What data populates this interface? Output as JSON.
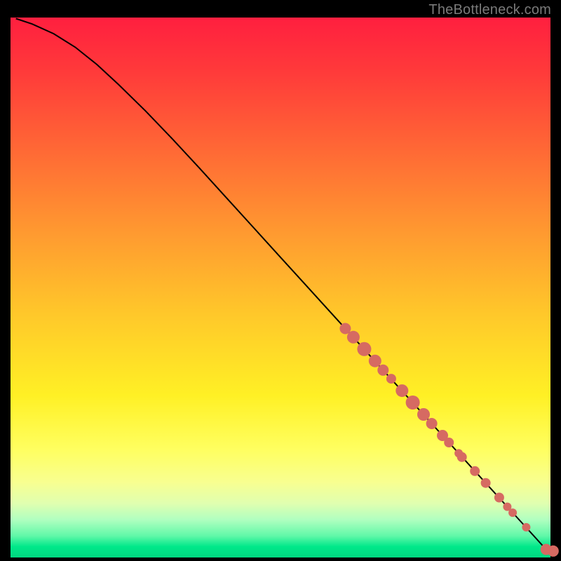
{
  "watermark": "TheBottleneck.com",
  "chart_data": {
    "type": "scatter",
    "title": "",
    "xlabel": "",
    "ylabel": "",
    "xlim": [
      0,
      100
    ],
    "ylim": [
      0,
      100
    ],
    "curve": [
      {
        "x": 1.0,
        "y": 99.8
      },
      {
        "x": 4.0,
        "y": 98.8
      },
      {
        "x": 8.0,
        "y": 97.0
      },
      {
        "x": 12.0,
        "y": 94.5
      },
      {
        "x": 16.0,
        "y": 91.3
      },
      {
        "x": 20.0,
        "y": 87.6
      },
      {
        "x": 25.0,
        "y": 82.7
      },
      {
        "x": 30.0,
        "y": 77.5
      },
      {
        "x": 35.0,
        "y": 72.1
      },
      {
        "x": 40.0,
        "y": 66.6
      },
      {
        "x": 45.0,
        "y": 61.1
      },
      {
        "x": 50.0,
        "y": 55.6
      },
      {
        "x": 55.0,
        "y": 50.1
      },
      {
        "x": 60.0,
        "y": 44.6
      },
      {
        "x": 65.0,
        "y": 39.1
      },
      {
        "x": 70.0,
        "y": 33.6
      },
      {
        "x": 75.0,
        "y": 28.1
      },
      {
        "x": 80.0,
        "y": 22.6
      },
      {
        "x": 85.0,
        "y": 17.1
      },
      {
        "x": 90.0,
        "y": 11.6
      },
      {
        "x": 95.0,
        "y": 6.1
      },
      {
        "x": 99.0,
        "y": 1.7
      }
    ],
    "series": [
      {
        "name": "points",
        "color": "#d66a62",
        "points": [
          {
            "x": 62.0,
            "y": 42.4,
            "r": 8
          },
          {
            "x": 63.5,
            "y": 40.8,
            "r": 9
          },
          {
            "x": 65.5,
            "y": 38.6,
            "r": 10
          },
          {
            "x": 67.5,
            "y": 36.4,
            "r": 9
          },
          {
            "x": 69.0,
            "y": 34.7,
            "r": 8
          },
          {
            "x": 70.5,
            "y": 33.1,
            "r": 7
          },
          {
            "x": 72.5,
            "y": 30.9,
            "r": 9
          },
          {
            "x": 74.5,
            "y": 28.7,
            "r": 10
          },
          {
            "x": 76.5,
            "y": 26.5,
            "r": 9
          },
          {
            "x": 78.0,
            "y": 24.8,
            "r": 8
          },
          {
            "x": 80.0,
            "y": 22.6,
            "r": 8
          },
          {
            "x": 81.2,
            "y": 21.3,
            "r": 7
          },
          {
            "x": 83.0,
            "y": 19.3,
            "r": 6
          },
          {
            "x": 83.6,
            "y": 18.6,
            "r": 7
          },
          {
            "x": 86.0,
            "y": 16.0,
            "r": 7
          },
          {
            "x": 88.0,
            "y": 13.8,
            "r": 7
          },
          {
            "x": 90.5,
            "y": 11.1,
            "r": 7
          },
          {
            "x": 92.0,
            "y": 9.4,
            "r": 6
          },
          {
            "x": 93.0,
            "y": 8.3,
            "r": 6
          },
          {
            "x": 95.5,
            "y": 5.6,
            "r": 6
          },
          {
            "x": 99.2,
            "y": 1.5,
            "r": 8
          },
          {
            "x": 100.5,
            "y": 1.2,
            "r": 8
          }
        ]
      }
    ]
  }
}
